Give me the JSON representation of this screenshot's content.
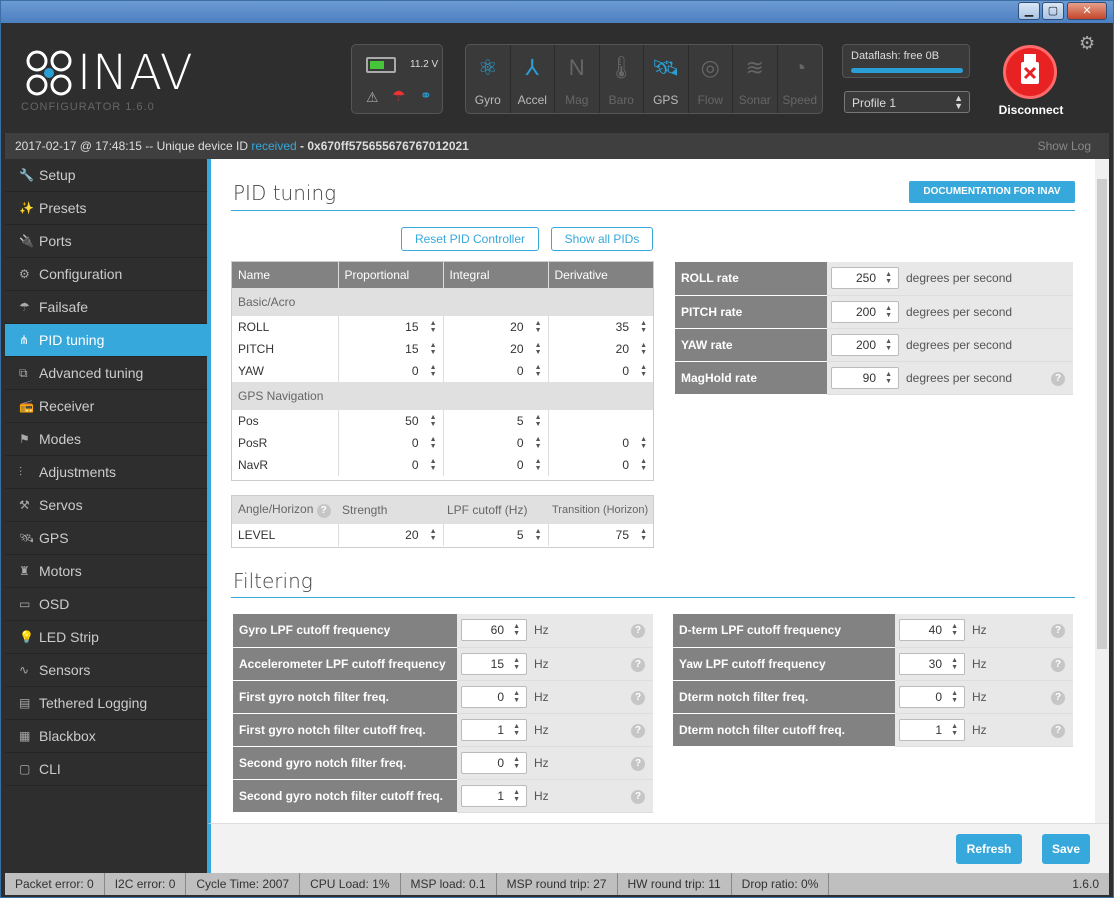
{
  "window": {
    "minimize": "▁",
    "maximize": "▢",
    "close": "✕"
  },
  "app": {
    "name": "INAV",
    "subtitle": "CONFIGURATOR  1.6.0"
  },
  "battery": {
    "voltage": "11.2 V"
  },
  "sensors": [
    {
      "label": "Gyro",
      "icon": "gyro-icon",
      "active": true
    },
    {
      "label": "Accel",
      "icon": "accel-icon",
      "active": true
    },
    {
      "label": "Mag",
      "icon": "mag-icon",
      "active": false
    },
    {
      "label": "Baro",
      "icon": "baro-icon",
      "active": false
    },
    {
      "label": "GPS",
      "icon": "gps-icon",
      "active": true
    },
    {
      "label": "Flow",
      "icon": "flow-icon",
      "active": false
    },
    {
      "label": "Sonar",
      "icon": "sonar-icon",
      "active": false
    },
    {
      "label": "Speed",
      "icon": "speed-icon",
      "active": false
    }
  ],
  "dataflash": {
    "label": "Dataflash: free 0B"
  },
  "profile": {
    "selected": "Profile 1"
  },
  "disconnect": {
    "label": "Disconnect"
  },
  "log": {
    "date": "2017-02-17 @ 17:48:15 -- Unique device ID ",
    "status": "received",
    "id": " - 0x670ff575655676767012021",
    "show": "Show Log"
  },
  "nav": [
    {
      "label": "Setup",
      "icon": "wrench-icon"
    },
    {
      "label": "Presets",
      "icon": "wand-icon"
    },
    {
      "label": "Ports",
      "icon": "plug-icon"
    },
    {
      "label": "Configuration",
      "icon": "gear-icon"
    },
    {
      "label": "Failsafe",
      "icon": "parachute-icon"
    },
    {
      "label": "PID tuning",
      "icon": "tree-icon",
      "active": true
    },
    {
      "label": "Advanced tuning",
      "icon": "advanced-icon"
    },
    {
      "label": "Receiver",
      "icon": "receiver-icon"
    },
    {
      "label": "Modes",
      "icon": "modes-icon"
    },
    {
      "label": "Adjustments",
      "icon": "sliders-icon"
    },
    {
      "label": "Servos",
      "icon": "servo-icon"
    },
    {
      "label": "GPS",
      "icon": "satellite-icon"
    },
    {
      "label": "Motors",
      "icon": "motor-icon"
    },
    {
      "label": "OSD",
      "icon": "osd-icon"
    },
    {
      "label": "LED Strip",
      "icon": "led-icon"
    },
    {
      "label": "Sensors",
      "icon": "pulse-icon"
    },
    {
      "label": "Tethered Logging",
      "icon": "log-icon"
    },
    {
      "label": "Blackbox",
      "icon": "blackbox-icon"
    },
    {
      "label": "CLI",
      "icon": "terminal-icon"
    }
  ],
  "pid": {
    "title": "PID tuning",
    "doc": "DOCUMENTATION FOR INAV",
    "reset": "Reset PID Controller",
    "showall": "Show all PIDs",
    "headers": [
      "Name",
      "Proportional",
      "Integral",
      "Derivative"
    ],
    "basic": "Basic/Acro",
    "roll": {
      "name": "ROLL",
      "p": "15",
      "i": "20",
      "d": "35"
    },
    "pitch": {
      "name": "PITCH",
      "p": "15",
      "i": "20",
      "d": "20"
    },
    "yaw": {
      "name": "YAW",
      "p": "0",
      "i": "0",
      "d": "0"
    },
    "gpsnav": "GPS Navigation",
    "pos": {
      "name": "Pos",
      "p": "50",
      "i": "5"
    },
    "posr": {
      "name": "PosR",
      "p": "0",
      "i": "0",
      "d": "0"
    },
    "navr": {
      "name": "NavR",
      "p": "0",
      "i": "0",
      "d": "0"
    },
    "angle": {
      "header": "Angle/Horizon",
      "strength": "Strength",
      "lpf": "LPF cutoff (Hz)",
      "transition": "Transition (Horizon)",
      "name": "LEVEL",
      "s": "20",
      "l": "5",
      "t": "75"
    }
  },
  "rates": {
    "unit": "degrees per second",
    "rows": [
      {
        "label": "ROLL rate",
        "value": "250"
      },
      {
        "label": "PITCH rate",
        "value": "200"
      },
      {
        "label": "YAW rate",
        "value": "200"
      },
      {
        "label": "MagHold rate",
        "value": "90"
      }
    ]
  },
  "filtering": {
    "title": "Filtering",
    "unit": "Hz",
    "left": [
      {
        "label": "Gyro LPF cutoff frequency",
        "value": "60"
      },
      {
        "label": "Accelerometer LPF cutoff frequency",
        "value": "15"
      },
      {
        "label": "First gyro notch filter freq.",
        "value": "0"
      },
      {
        "label": "First gyro notch filter cutoff freq.",
        "value": "1"
      },
      {
        "label": "Second gyro notch filter freq.",
        "value": "0"
      },
      {
        "label": "Second gyro notch filter cutoff freq.",
        "value": "1"
      }
    ],
    "right": [
      {
        "label": "D-term LPF cutoff frequency",
        "value": "40"
      },
      {
        "label": "Yaw LPF cutoff frequency",
        "value": "30"
      },
      {
        "label": "Dterm notch filter freq.",
        "value": "0"
      },
      {
        "label": "Dterm notch filter cutoff freq.",
        "value": "1"
      }
    ]
  },
  "actions": {
    "refresh": "Refresh",
    "save": "Save"
  },
  "status": [
    "Packet error: 0",
    "I2C error: 0",
    "Cycle Time: 2007",
    "CPU Load: 1%",
    "MSP load: 0.1",
    "MSP round trip: 27",
    "HW round trip: 11",
    "Drop ratio: 0%"
  ],
  "version": "1.6.0"
}
